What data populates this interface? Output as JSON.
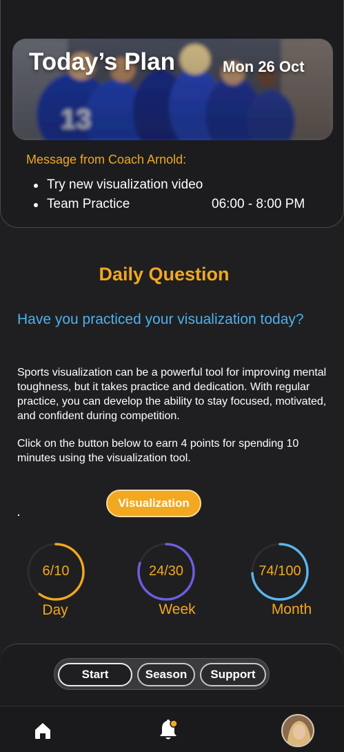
{
  "header": {
    "title": "Today’s Plan",
    "date": "Mon 26 Oct"
  },
  "coach": {
    "message_title": "Message from Coach Arnold:",
    "items": [
      {
        "label": "Try new visualization video",
        "time": ""
      },
      {
        "label": "Team Practice",
        "time": "06:00 - 8:00 PM"
      }
    ]
  },
  "daily_question": {
    "title": "Daily Question",
    "question": "Have you practiced your visualization today?",
    "paragraph1": "Sports visualization can be a powerful tool for improving mental toughness, but it takes practice and dedication. With regular practice, you can develop the ability to stay focused, motivated, and confident during competition.",
    "paragraph2": "Click on the button below to earn 4 points for spending 10 minutes using the visualization tool.",
    "button_label": "Visualization"
  },
  "progress": [
    {
      "value_text": "6/10",
      "label": "Day",
      "fraction": 0.6,
      "color": "#f2a81f"
    },
    {
      "value_text": "24/30",
      "label": "Week",
      "fraction": 0.8,
      "color": "#6b5fe0"
    },
    {
      "value_text": "74/100",
      "label": "Month",
      "fraction": 0.74,
      "color": "#5bb6ec"
    }
  ],
  "segments": [
    {
      "label": "Start",
      "active": true
    },
    {
      "label": "Season",
      "active": false
    },
    {
      "label": "Support",
      "active": false
    }
  ],
  "tabbar": {
    "icons": [
      "home-icon",
      "bell-icon",
      "avatar"
    ],
    "notification_color": "#f2a81f"
  },
  "colors": {
    "accent": "#f2a81f",
    "question": "#4fb0ec",
    "background": "#1f1f21"
  }
}
